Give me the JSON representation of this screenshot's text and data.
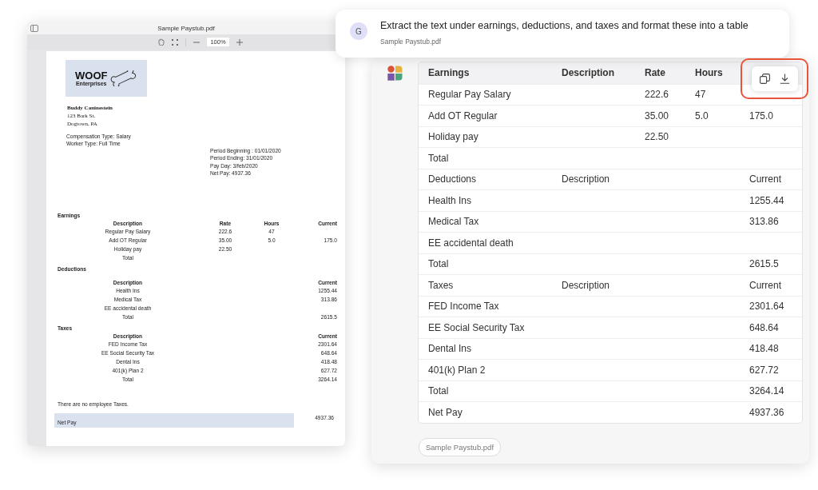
{
  "pdf_viewer": {
    "title": "Sample Paystub.pdf",
    "zoom": "100%",
    "document": {
      "logo": {
        "name": "WOOF",
        "subtitle": "Enterprises"
      },
      "employee": {
        "name": "Buddy Caninestein",
        "address_lines": [
          "123 Bark St.",
          "Dogtown, PA"
        ]
      },
      "details": [
        "Compensation Type: Salary",
        "Worker Type: Full Time"
      ],
      "period": [
        "Period Beginning : 01/01/2020",
        "Period Ending: 31/01/2020",
        "Pay Day: 3/feb/2020",
        "Net Pay: 4937.36"
      ],
      "sections": [
        {
          "title": "Earnings",
          "header": {
            "description": "Description",
            "rate": "Rate",
            "hours": "Hours",
            "current": "Current"
          },
          "rows": [
            {
              "description": "Regular Pay Salary",
              "rate": "222.6",
              "hours": "47"
            },
            {
              "description": "Add OT Regular",
              "rate": "35.00",
              "hours": "5.0",
              "current": "175.0"
            },
            {
              "description": "Holiday pay",
              "rate": "22.50"
            },
            {
              "description": "Total"
            }
          ]
        },
        {
          "title": "Deductions",
          "header": {
            "description": "Description",
            "current": "Current"
          },
          "rows": [
            {
              "description": "Health Ins",
              "current": "1255.44"
            },
            {
              "description": "Medical Tax",
              "current": "313.86"
            },
            {
              "description": "EE accidental death"
            },
            {
              "description": "Total",
              "current": "2615.5"
            }
          ]
        },
        {
          "title": "Taxes",
          "header": {
            "description": "Description",
            "current": "Current"
          },
          "rows": [
            {
              "description": "FED Income Tax",
              "current": "2301.64"
            },
            {
              "description": "EE Social Security Tax",
              "current": "648.64"
            },
            {
              "description": "Dental Ins",
              "current": "418.48"
            },
            {
              "description": "401(k) Plan 2",
              "current": "627.72"
            },
            {
              "description": "Total",
              "current": "3264.14"
            }
          ]
        }
      ],
      "note": "There are no employee Taxes.",
      "net_pay": {
        "label": "Net Pay",
        "value": "4937.36"
      }
    }
  },
  "prompt": {
    "avatar": "G",
    "text": "Extract the text under earnings, deductions, and taxes and format these into a table",
    "attachment": "Sample Paystub.pdf"
  },
  "answer": {
    "table": [
      {
        "kind": "header",
        "item": "Earnings",
        "description": "Description",
        "rate": "Rate",
        "hours": "Hours"
      },
      {
        "kind": "row",
        "item": "Regular Pay Salary",
        "rate": "222.6",
        "hours": "47"
      },
      {
        "kind": "row",
        "item": "Add OT Regular",
        "rate": "35.00",
        "hours": "5.0",
        "current": "175.0"
      },
      {
        "kind": "row",
        "item": "Holiday pay",
        "rate": "22.50"
      },
      {
        "kind": "row",
        "item": "Total"
      },
      {
        "kind": "row",
        "item": "Deductions",
        "description": "Description",
        "current": "Current"
      },
      {
        "kind": "row",
        "item": "Health Ins",
        "current": "1255.44"
      },
      {
        "kind": "row",
        "item": "Medical Tax",
        "current": "313.86"
      },
      {
        "kind": "row",
        "item": "EE accidental death"
      },
      {
        "kind": "row",
        "item": "Total",
        "current": "2615.5"
      },
      {
        "kind": "row",
        "item": "Taxes",
        "description": "Description",
        "current": "Current"
      },
      {
        "kind": "row",
        "item": "FED Income Tax",
        "current": "2301.64"
      },
      {
        "kind": "row",
        "item": "EE Social Security Tax",
        "current": "648.64"
      },
      {
        "kind": "row",
        "item": "Dental Ins",
        "current": "418.48"
      },
      {
        "kind": "row",
        "item": "401(k) Plan 2",
        "current": "627.72"
      },
      {
        "kind": "row",
        "item": "Total",
        "current": "3264.14"
      },
      {
        "kind": "row",
        "item": "Net Pay",
        "current": "4937.36"
      }
    ],
    "source_chip": "Sample Paystub.pdf"
  }
}
